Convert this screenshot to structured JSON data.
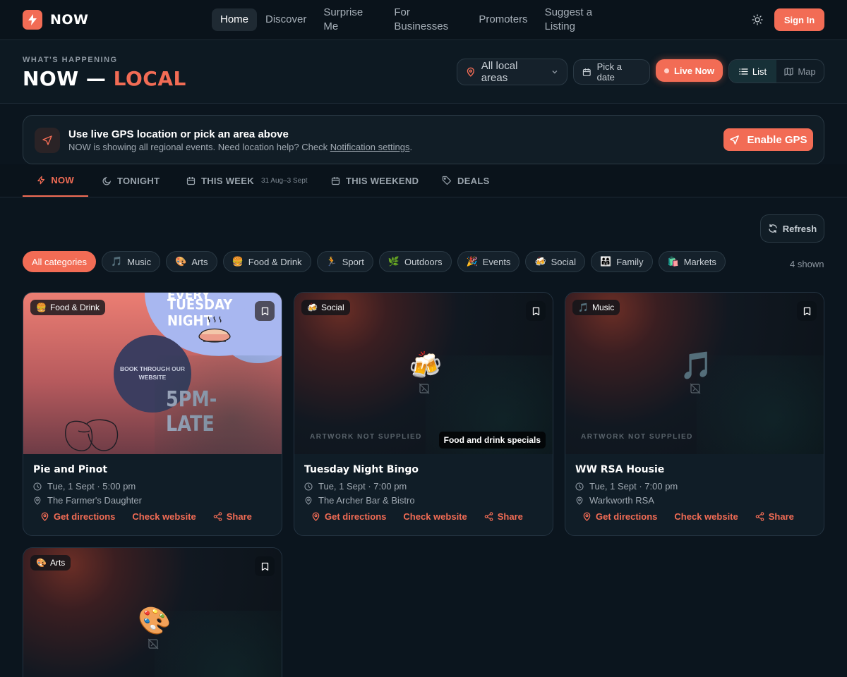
{
  "brand": {
    "name": "NOW"
  },
  "nav": {
    "items": [
      {
        "label": "Home"
      },
      {
        "label": "Discover"
      },
      {
        "label": "Surprise Me"
      },
      {
        "label": "For Businesses"
      },
      {
        "label": "Promoters"
      },
      {
        "label": "Suggest a Listing"
      }
    ],
    "signin": "Sign In"
  },
  "header": {
    "eyebrow": "WHAT'S HAPPENING",
    "title_main": "NOW —",
    "title_accent": "LOCAL",
    "area": "All local areas",
    "date": "Pick a date",
    "live": "Live Now",
    "view_list": "List",
    "view_map": "Map"
  },
  "gps": {
    "title": "Use live GPS location or pick an area above",
    "text": "NOW is showing all regional events. Need location help? Check",
    "link": "Notification settings",
    "tail": ".",
    "button": "Enable GPS"
  },
  "tabs": [
    {
      "label": "NOW"
    },
    {
      "label": "TONIGHT"
    },
    {
      "label": "THIS WEEK",
      "sub": "31 Aug–3 Sept"
    },
    {
      "label": "THIS WEEKEND"
    },
    {
      "label": "DEALS"
    }
  ],
  "toolbar": {
    "refresh": "Refresh",
    "shown": "4 shown"
  },
  "categories": [
    {
      "label": "All categories",
      "icon": ""
    },
    {
      "label": "Music",
      "icon": "🎵"
    },
    {
      "label": "Arts",
      "icon": "🎨"
    },
    {
      "label": "Food & Drink",
      "icon": "🍔"
    },
    {
      "label": "Sport",
      "icon": "🏃"
    },
    {
      "label": "Outdoors",
      "icon": "🌿"
    },
    {
      "label": "Events",
      "icon": "🎉"
    },
    {
      "label": "Social",
      "icon": "🍻"
    },
    {
      "label": "Family",
      "icon": "👨‍👩‍👧"
    },
    {
      "label": "Markets",
      "icon": "🛍️"
    }
  ],
  "colors": {
    "accent": "#f26c55",
    "background": "#0b151e"
  },
  "cards": [
    {
      "badge_icon": "🍔",
      "badge": "Food & Drink",
      "title": "Pie and Pinot",
      "time": "Tue, 1 Sept · 5:00 pm",
      "venue": "The Farmer's Daughter",
      "flyer": {
        "line1": "EVERY",
        "line2": "TUESDAY NIGHT",
        "circle": "BOOK THROUGH OUR WEBSITE",
        "time": "5PM- LATE"
      }
    },
    {
      "badge_icon": "🍻",
      "badge": "Social",
      "title": "Tuesday Night Bingo",
      "time": "Tue, 1 Sept · 7:00 pm",
      "venue": "The Archer Bar & Bistro",
      "emoji": "🍻",
      "note": "ARTWORK NOT SUPPLIED",
      "tag": "Food and drink specials"
    },
    {
      "badge_icon": "🎵",
      "badge": "Music",
      "title": "WW RSA Housie",
      "time": "Tue, 1 Sept · 7:00 pm",
      "venue": "Warkworth RSA",
      "emoji": "🎵",
      "note": "ARTWORK NOT SUPPLIED"
    },
    {
      "badge_icon": "🎨",
      "badge": "Arts",
      "emoji": "🎨"
    }
  ],
  "actions": {
    "directions": "Get directions",
    "website": "Check website",
    "share": "Share"
  }
}
